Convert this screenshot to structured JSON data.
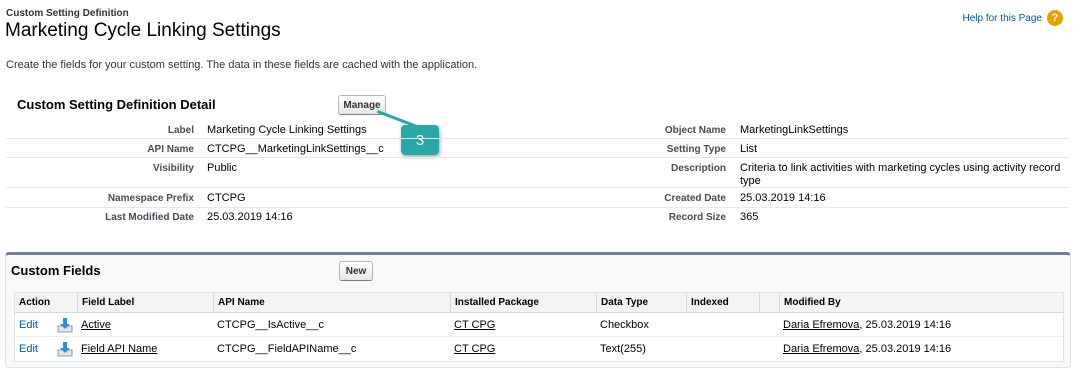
{
  "header": {
    "breadcrumb": "Custom Setting Definition",
    "title": "Marketing Cycle Linking Settings",
    "help_link": "Help for this Page",
    "help_icon": "?"
  },
  "intro": "Create the fields for your custom setting. The data in these fields are cached with the application.",
  "detail": {
    "section_title": "Custom Setting Definition Detail",
    "manage_label": "Manage",
    "callout_number": "3",
    "rows": [
      {
        "label1": "Label",
        "value1": "Marketing Cycle Linking Settings",
        "label2": "Object Name",
        "value2": "MarketingLinkSettings"
      },
      {
        "label1": "API Name",
        "value1": "CTCPG__MarketingLinkSettings__c",
        "label2": "Setting Type",
        "value2": "List"
      },
      {
        "label1": "Visibility",
        "value1": "Public",
        "label2": "Description",
        "value2": "Criteria to link activities with marketing cycles using activity record type"
      },
      {
        "label1": "Namespace Prefix",
        "value1": "CTCPG",
        "label2": "Created Date",
        "value2": "25.03.2019 14:16"
      },
      {
        "label1": "Last Modified Date",
        "value1": "25.03.2019 14:16",
        "label2": "Record Size",
        "value2": "365"
      }
    ]
  },
  "custom_fields": {
    "section_title": "Custom Fields",
    "new_label": "New",
    "columns": [
      "Action",
      "Field Label",
      "API Name",
      "Installed Package",
      "Data Type",
      "Indexed",
      "",
      "Modified By"
    ],
    "rows": [
      {
        "action": "Edit",
        "field_label": "Active",
        "api_name": "CTCPG__IsActive__c",
        "package": "CT CPG",
        "data_type": "Checkbox",
        "indexed": "",
        "modified_by": "Daria Efremova",
        "modified_date": ", 25.03.2019 14:16"
      },
      {
        "action": "Edit",
        "field_label": "Field API Name",
        "api_name": "CTCPG__FieldAPIName__c",
        "package": "CT CPG",
        "data_type": "Text(255)",
        "indexed": "",
        "modified_by": "Daria Efremova",
        "modified_date": ", 25.03.2019 14:16"
      }
    ]
  },
  "colors": {
    "link": "#015ba7",
    "callout": "#2aa8a8",
    "help_icon": "#e8a200",
    "section_border": "#747e96"
  },
  "icons": {
    "help": "help-icon",
    "package": "managed-package-icon"
  }
}
